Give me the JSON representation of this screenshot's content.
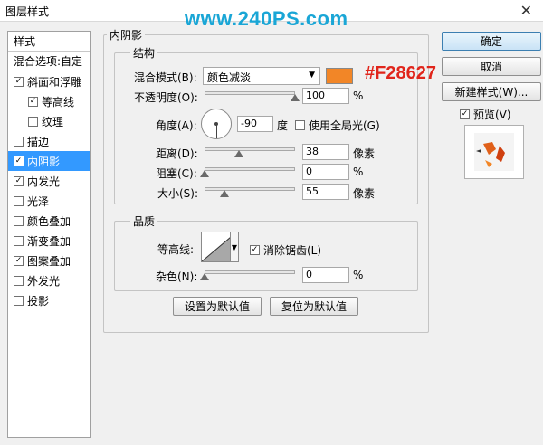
{
  "window": {
    "title": "图层样式",
    "close": "✕"
  },
  "watermark": "www.240PS.com",
  "styles_list": [
    {
      "label": "样式",
      "checkbox": false,
      "checked": false,
      "selected": false,
      "indent": 0
    },
    {
      "label": "混合选项:自定",
      "checkbox": false,
      "checked": false,
      "selected": false,
      "indent": 0
    },
    {
      "label": "斜面和浮雕",
      "checkbox": true,
      "checked": true,
      "selected": false,
      "indent": 0
    },
    {
      "label": "等高线",
      "checkbox": true,
      "checked": true,
      "selected": false,
      "indent": 1
    },
    {
      "label": "纹理",
      "checkbox": true,
      "checked": false,
      "selected": false,
      "indent": 1
    },
    {
      "label": "描边",
      "checkbox": true,
      "checked": false,
      "selected": false,
      "indent": 0
    },
    {
      "label": "内阴影",
      "checkbox": true,
      "checked": true,
      "selected": true,
      "indent": 0
    },
    {
      "label": "内发光",
      "checkbox": true,
      "checked": true,
      "selected": false,
      "indent": 0
    },
    {
      "label": "光泽",
      "checkbox": true,
      "checked": false,
      "selected": false,
      "indent": 0
    },
    {
      "label": "颜色叠加",
      "checkbox": true,
      "checked": false,
      "selected": false,
      "indent": 0
    },
    {
      "label": "渐变叠加",
      "checkbox": true,
      "checked": false,
      "selected": false,
      "indent": 0
    },
    {
      "label": "图案叠加",
      "checkbox": true,
      "checked": true,
      "selected": false,
      "indent": 0
    },
    {
      "label": "外发光",
      "checkbox": true,
      "checked": false,
      "selected": false,
      "indent": 0
    },
    {
      "label": "投影",
      "checkbox": true,
      "checked": false,
      "selected": false,
      "indent": 0
    }
  ],
  "panel": {
    "title": "内阴影",
    "structure": {
      "title": "结构",
      "blend_mode_label": "混合模式(B):",
      "blend_mode_value": "颜色减淡",
      "color": "#f28627",
      "color_hex_label": "#F28627",
      "opacity_label": "不透明度(O):",
      "opacity_value": "100",
      "opacity_fraction": 1.0,
      "percent": "%",
      "angle_label": "角度(A):",
      "angle_value": "-90",
      "angle_unit": "度",
      "global_light_label": "使用全局光(G)",
      "global_light_checked": false,
      "distance_label": "距离(D):",
      "distance_value": "38",
      "distance_fraction": 0.38,
      "pixels": "像素",
      "choke_label": "阻塞(C):",
      "choke_value": "0",
      "choke_fraction": 0.0,
      "size_label": "大小(S):",
      "size_value": "55",
      "size_fraction": 0.22
    },
    "quality": {
      "title": "品质",
      "contour_label": "等高线:",
      "antialias_label": "消除锯齿(L)",
      "antialias_checked": true,
      "noise_label": "杂色(N):",
      "noise_value": "0",
      "noise_fraction": 0.0,
      "percent": "%"
    },
    "make_default": "设置为默认值",
    "reset_default": "复位为默认值"
  },
  "buttons": {
    "ok": "确定",
    "cancel": "取消",
    "new_style": "新建样式(W)...",
    "preview_label": "预览(V)",
    "preview_checked": true
  }
}
